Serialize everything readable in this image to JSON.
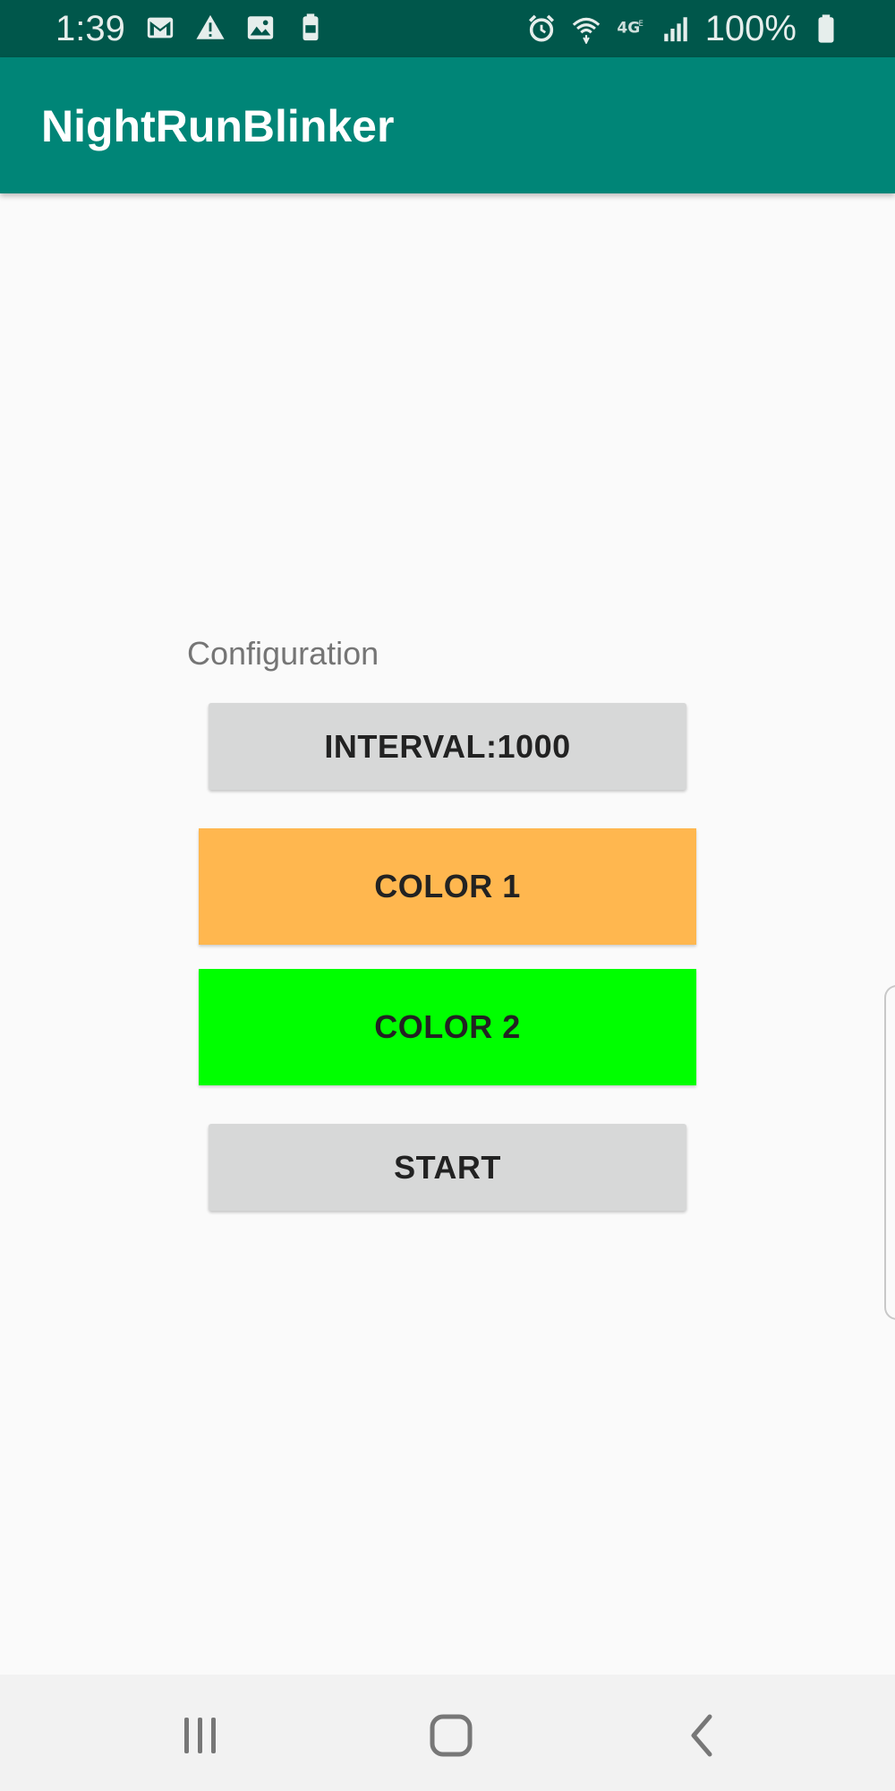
{
  "status_bar": {
    "time": "1:39",
    "battery_percent": "100%",
    "left_icons": [
      "gmail-icon",
      "warning-icon",
      "image-icon",
      "battery-saver-icon"
    ],
    "right_icons": [
      "alarm-icon",
      "wifi-icon",
      "4g-icon",
      "signal-icon",
      "battery-icon"
    ]
  },
  "app_bar": {
    "title": "NightRunBlinker"
  },
  "main": {
    "section_label": "Configuration",
    "interval_button": "INTERVAL:1000",
    "color1_button": "COLOR 1",
    "color2_button": "COLOR 2",
    "start_button": "START"
  },
  "colors": {
    "app_bar": "#008577",
    "status_bar": "#00574b",
    "color1": "#ffb74f",
    "color2": "#00ff00",
    "button_gray": "#d7d8d8",
    "background": "#fafafa"
  },
  "nav_bar": {
    "items": [
      "recents-icon",
      "home-icon",
      "back-icon"
    ]
  }
}
